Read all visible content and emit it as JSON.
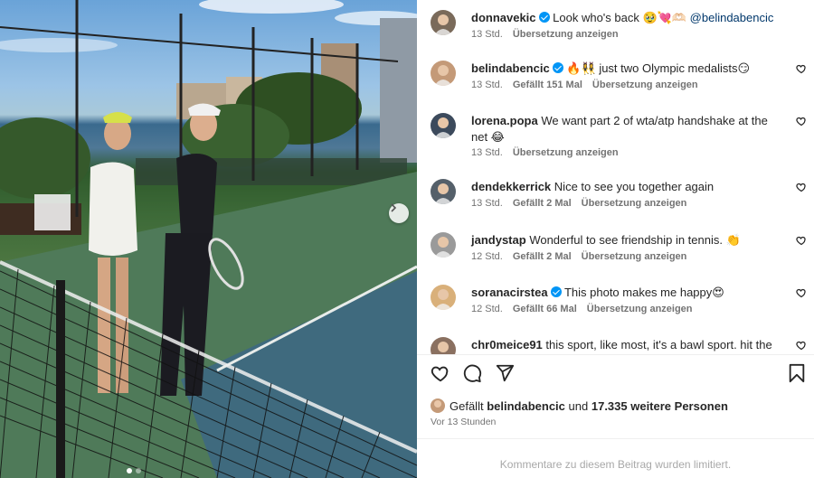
{
  "post": {
    "comments": [
      {
        "user": "donnavekic",
        "verified": true,
        "text": "Look who's back 🥹💘🫶🏻",
        "mention": "@belindabencic",
        "time": "13 Std.",
        "likes": "",
        "translate": "Übersetzung anzeigen",
        "avatar_color": "#7a6a5a",
        "has_heart": false
      },
      {
        "user": "belindabencic",
        "verified": true,
        "text": "🔥👯‍♀️ just two Olympic medalists😏",
        "mention": "",
        "time": "13 Std.",
        "likes": "Gefällt 151 Mal",
        "translate": "Übersetzung anzeigen",
        "avatar_color": "#c49a78",
        "has_heart": true
      },
      {
        "user": "lorena.popa",
        "verified": false,
        "text": "We want part 2 of wta/atp handshake at the net 😂",
        "mention": "",
        "time": "13 Std.",
        "likes": "",
        "translate": "Übersetzung anzeigen",
        "avatar_color": "#3c4a5c",
        "has_heart": true
      },
      {
        "user": "dendekkerrick",
        "verified": false,
        "text": "Nice to see you together again",
        "mention": "",
        "time": "13 Std.",
        "likes": "Gefällt 2 Mal",
        "translate": "Übersetzung anzeigen",
        "avatar_color": "#55606a",
        "has_heart": true
      },
      {
        "user": "jandystap",
        "verified": false,
        "text": "Wonderful to see friendship in tennis. 👏",
        "mention": "",
        "time": "12 Std.",
        "likes": "Gefällt 2 Mal",
        "translate": "Übersetzung anzeigen",
        "avatar_color": "#9a9a9a",
        "has_heart": true
      },
      {
        "user": "soranacirstea",
        "verified": true,
        "text": "This photo makes me happy😍",
        "mention": "",
        "time": "12 Std.",
        "likes": "Gefällt 66 Mal",
        "translate": "Übersetzung anzeigen",
        "avatar_color": "#d9b07a",
        "has_heart": true
      },
      {
        "user": "chr0meice91",
        "verified": false,
        "text": "this sport, like most, it's a bawl sport. hit the",
        "mention": "",
        "time": "",
        "likes": "",
        "translate": "",
        "avatar_color": "#8a7060",
        "has_heart": true
      }
    ],
    "likes_prefix": "Gefällt",
    "likes_user": "belindabencic",
    "likes_mid": "und",
    "likes_count": "17.335 weitere Personen",
    "posted_ago": "Vor 13 Stunden",
    "comments_limited": "Kommentare zu diesem Beitrag wurden limitiert."
  },
  "icons": {
    "like": "heart-icon",
    "comment": "comment-icon",
    "share": "send-icon",
    "save": "bookmark-icon",
    "next": "chevron-right-icon"
  },
  "colors": {
    "verified": "#0095f6",
    "muted": "#737373",
    "text": "#262626"
  },
  "carousel": {
    "slides": 2,
    "active": 1
  }
}
